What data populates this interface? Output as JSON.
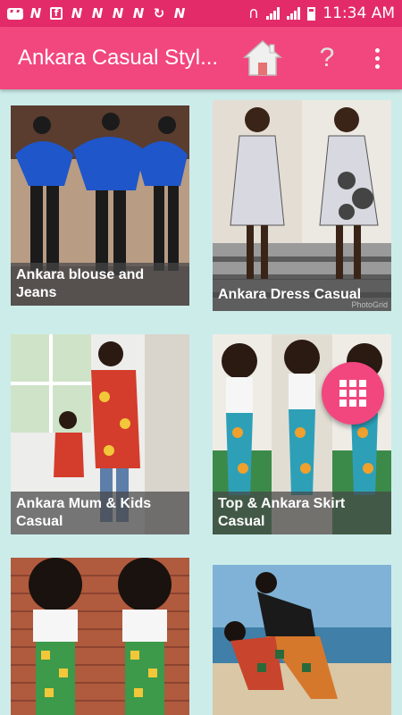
{
  "status_bar": {
    "time": "11:34 AM",
    "notification_icons": [
      "message-icon",
      "n-icon",
      "facebook-icon",
      "n-icon",
      "n-icon",
      "n-icon",
      "n-icon",
      "sync-icon",
      "n-icon"
    ]
  },
  "app_bar": {
    "title": "Ankara Casual Styl...",
    "home_icon": "home-icon",
    "help_label": "?",
    "menu_icon": "overflow-menu-icon"
  },
  "cards": [
    {
      "caption": "Ankara blouse and Jeans"
    },
    {
      "caption": "Ankara Dress Casual",
      "watermark": "PhotoGrid"
    },
    {
      "caption": "Ankara Mum & Kids Casual"
    },
    {
      "caption": "Top & Ankara Skirt Casual"
    },
    {
      "caption": ""
    },
    {
      "caption": ""
    }
  ],
  "fab": {
    "icon": "grid-apps-icon"
  },
  "colors": {
    "status_bar": "#e42b6a",
    "app_bar": "#f2467f",
    "background": "#ccecea"
  }
}
